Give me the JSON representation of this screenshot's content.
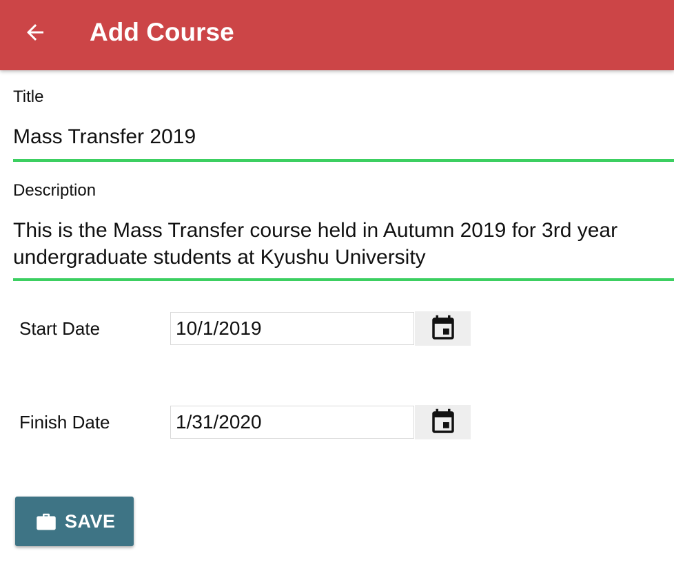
{
  "app_bar": {
    "title": "Add Course",
    "back_icon": "arrow-left-icon",
    "color": "#cc4547"
  },
  "form": {
    "title": {
      "label": "Title",
      "value": "Mass Transfer 2019"
    },
    "description": {
      "label": "Description",
      "value": "This is the Mass Transfer course held in Autumn 2019 for 3rd year undergraduate students at Kyushu University"
    },
    "start_date": {
      "label": "Start Date",
      "value": "10/1/2019",
      "picker_icon": "calendar-icon"
    },
    "finish_date": {
      "label": "Finish Date",
      "value": "1/31/2020",
      "picker_icon": "calendar-icon"
    },
    "underline_color": "#3ccf61"
  },
  "actions": {
    "save_label": "SAVE",
    "save_icon": "briefcase-icon",
    "save_color": "#3e7485"
  }
}
